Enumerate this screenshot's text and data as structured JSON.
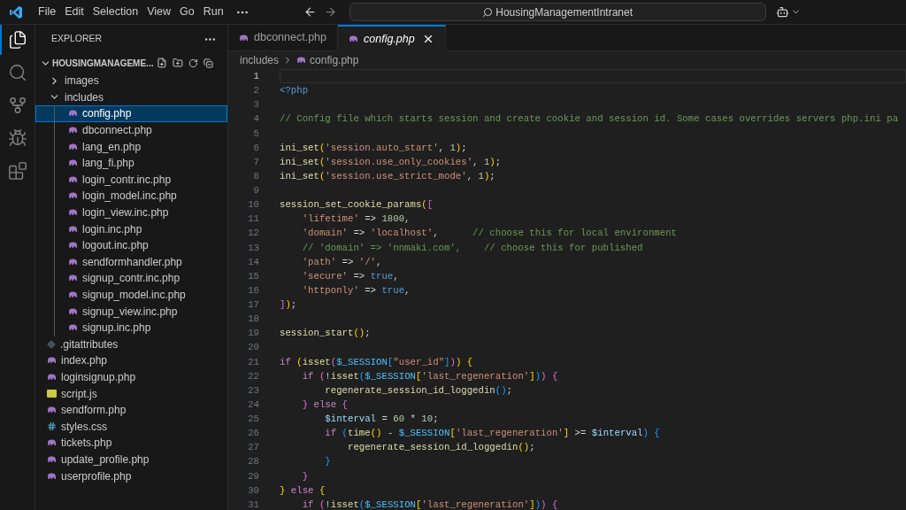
{
  "menu": [
    "File",
    "Edit",
    "Selection",
    "View",
    "Go",
    "Run"
  ],
  "search": {
    "value": "HousingManagementIntranet"
  },
  "activity_bar": [
    {
      "kind": "files",
      "selected": true
    },
    {
      "kind": "search",
      "selected": false
    },
    {
      "kind": "source-control",
      "selected": false
    },
    {
      "kind": "run",
      "selected": false
    },
    {
      "kind": "extensions",
      "selected": false
    }
  ],
  "explorer": {
    "title": "EXPLORER",
    "root": {
      "label": "HOUSINGMANAGEME...",
      "expanded": true,
      "children": [
        {
          "label": "images",
          "kind": "folder",
          "expanded": false,
          "selected": false
        },
        {
          "label": "includes",
          "kind": "folder",
          "expanded": true,
          "selected": false,
          "children": [
            {
              "label": "config.php",
              "kind": "php",
              "selected": true
            },
            {
              "label": "dbconnect.php",
              "kind": "php",
              "selected": false
            },
            {
              "label": "lang_en.php",
              "kind": "php",
              "selected": false
            },
            {
              "label": "lang_fi.php",
              "kind": "php",
              "selected": false
            },
            {
              "label": "login_contr.inc.php",
              "kind": "php",
              "selected": false
            },
            {
              "label": "login_model.inc.php",
              "kind": "php",
              "selected": false
            },
            {
              "label": "login_view.inc.php",
              "kind": "php",
              "selected": false
            },
            {
              "label": "login.inc.php",
              "kind": "php",
              "selected": false
            },
            {
              "label": "logout.inc.php",
              "kind": "php",
              "selected": false
            },
            {
              "label": "sendformhandler.php",
              "kind": "php",
              "selected": false
            },
            {
              "label": "signup_contr.inc.php",
              "kind": "php",
              "selected": false
            },
            {
              "label": "signup_model.inc.php",
              "kind": "php",
              "selected": false
            },
            {
              "label": "signup_view.inc.php",
              "kind": "php",
              "selected": false
            },
            {
              "label": "signup.inc.php",
              "kind": "php",
              "selected": false
            }
          ]
        },
        {
          "label": ".gitattributes",
          "kind": "git",
          "selected": false
        },
        {
          "label": "index.php",
          "kind": "php",
          "selected": false
        },
        {
          "label": "loginsignup.php",
          "kind": "php",
          "selected": false
        },
        {
          "label": "script.js",
          "kind": "js",
          "selected": false
        },
        {
          "label": "sendform.php",
          "kind": "php",
          "selected": false
        },
        {
          "label": "styles.css",
          "kind": "css",
          "selected": false
        },
        {
          "label": "tickets.php",
          "kind": "php",
          "selected": false
        },
        {
          "label": "update_profile.php",
          "kind": "php",
          "selected": false
        },
        {
          "label": "userprofile.php",
          "kind": "php",
          "selected": false
        }
      ]
    }
  },
  "tabs": [
    {
      "label": "dbconnect.php",
      "selected": false,
      "preview": false
    },
    {
      "label": "config.php",
      "selected": true,
      "preview": true
    }
  ],
  "breadcrumb": [
    "includes",
    "config.php"
  ],
  "code": [
    {
      "number": "1",
      "current": true
    },
    {
      "number": "2",
      "current": false,
      "tokens": [
        {
          "kind": "tag",
          "text": "<?php"
        }
      ]
    },
    {
      "number": "3",
      "current": false
    },
    {
      "number": "4",
      "current": false,
      "tokens": [
        {
          "kind": "comment",
          "text": "// Config file which starts session and create cookie and session id. Some cases overrides servers php.ini pa"
        }
      ]
    },
    {
      "number": "5",
      "current": false
    },
    {
      "number": "6",
      "current": false,
      "tokens": [
        {
          "kind": "fn",
          "text": "ini_set"
        },
        {
          "kind": "b1",
          "text": "("
        },
        {
          "kind": "str",
          "text": "'session.auto_start'"
        },
        {
          "kind": "p",
          "text": ", "
        },
        {
          "kind": "num",
          "text": "1"
        },
        {
          "kind": "b1",
          "text": ")"
        },
        {
          "kind": "p",
          "text": ";"
        }
      ]
    },
    {
      "number": "7",
      "current": false,
      "tokens": [
        {
          "kind": "fn",
          "text": "ini_set"
        },
        {
          "kind": "b1",
          "text": "("
        },
        {
          "kind": "str",
          "text": "'session.use_only_cookies'"
        },
        {
          "kind": "p",
          "text": ", "
        },
        {
          "kind": "num",
          "text": "1"
        },
        {
          "kind": "b1",
          "text": ")"
        },
        {
          "kind": "p",
          "text": ";"
        }
      ]
    },
    {
      "number": "8",
      "current": false,
      "tokens": [
        {
          "kind": "fn",
          "text": "ini_set"
        },
        {
          "kind": "b1",
          "text": "("
        },
        {
          "kind": "str",
          "text": "'session.use_strict_mode'"
        },
        {
          "kind": "p",
          "text": ", "
        },
        {
          "kind": "num",
          "text": "1"
        },
        {
          "kind": "b1",
          "text": ")"
        },
        {
          "kind": "p",
          "text": ";"
        }
      ]
    },
    {
      "number": "9",
      "current": false
    },
    {
      "number": "10",
      "current": false,
      "tokens": [
        {
          "kind": "fn",
          "text": "session_set_cookie_params"
        },
        {
          "kind": "b1",
          "text": "("
        },
        {
          "kind": "b2",
          "text": "["
        }
      ]
    },
    {
      "number": "11",
      "current": false,
      "tokens": [
        {
          "kind": "str",
          "text": "    'lifetime'"
        },
        {
          "kind": "p",
          "text": " => "
        },
        {
          "kind": "num",
          "text": "1800"
        },
        {
          "kind": "p",
          "text": ","
        }
      ]
    },
    {
      "number": "12",
      "current": false,
      "tokens": [
        {
          "kind": "str",
          "text": "    'domain'"
        },
        {
          "kind": "p",
          "text": " => "
        },
        {
          "kind": "str",
          "text": "'localhost'"
        },
        {
          "kind": "p",
          "text": ",      "
        },
        {
          "kind": "comment",
          "text": "// choose this for local environment"
        }
      ]
    },
    {
      "number": "13",
      "current": false,
      "tokens": [
        {
          "kind": "comment",
          "text": "    // 'domain' => 'nnmaki.com',    // choose this for published"
        }
      ]
    },
    {
      "number": "14",
      "current": false,
      "tokens": [
        {
          "kind": "str",
          "text": "    'path'"
        },
        {
          "kind": "p",
          "text": " => "
        },
        {
          "kind": "str",
          "text": "'/'"
        },
        {
          "kind": "p",
          "text": ","
        }
      ]
    },
    {
      "number": "15",
      "current": false,
      "tokens": [
        {
          "kind": "str",
          "text": "    'secure'"
        },
        {
          "kind": "p",
          "text": " => "
        },
        {
          "kind": "const",
          "text": "true"
        },
        {
          "kind": "p",
          "text": ","
        }
      ]
    },
    {
      "number": "16",
      "current": false,
      "tokens": [
        {
          "kind": "str",
          "text": "    'httponly'"
        },
        {
          "kind": "p",
          "text": " => "
        },
        {
          "kind": "const",
          "text": "true"
        },
        {
          "kind": "p",
          "text": ","
        }
      ]
    },
    {
      "number": "17",
      "current": false,
      "tokens": [
        {
          "kind": "b2",
          "text": "]"
        },
        {
          "kind": "b1",
          "text": ")"
        },
        {
          "kind": "p",
          "text": ";"
        }
      ]
    },
    {
      "number": "18",
      "current": false
    },
    {
      "number": "19",
      "current": false,
      "tokens": [
        {
          "kind": "fn",
          "text": "session_start"
        },
        {
          "kind": "b1",
          "text": "()"
        },
        {
          "kind": "p",
          "text": ";"
        }
      ]
    },
    {
      "number": "20",
      "current": false
    },
    {
      "number": "21",
      "current": false,
      "tokens": [
        {
          "kind": "kw",
          "text": "if "
        },
        {
          "kind": "b1",
          "text": "("
        },
        {
          "kind": "fn",
          "text": "isset"
        },
        {
          "kind": "b2",
          "text": "("
        },
        {
          "kind": "global",
          "text": "$_SESSION"
        },
        {
          "kind": "b3",
          "text": "["
        },
        {
          "kind": "str",
          "text": "\"user_id\""
        },
        {
          "kind": "b3",
          "text": "]"
        },
        {
          "kind": "b2",
          "text": ")"
        },
        {
          "kind": "b1",
          "text": ") {"
        }
      ]
    },
    {
      "number": "22",
      "current": false,
      "tokens": [
        {
          "kind": "kw",
          "text": "    if "
        },
        {
          "kind": "b2",
          "text": "("
        },
        {
          "kind": "p",
          "text": "!"
        },
        {
          "kind": "fn",
          "text": "isset"
        },
        {
          "kind": "b3",
          "text": "("
        },
        {
          "kind": "global",
          "text": "$_SESSION"
        },
        {
          "kind": "b1",
          "text": "["
        },
        {
          "kind": "str",
          "text": "'last_regeneration'"
        },
        {
          "kind": "b1",
          "text": "]"
        },
        {
          "kind": "b3",
          "text": ")"
        },
        {
          "kind": "b2",
          "text": ") {"
        }
      ]
    },
    {
      "number": "23",
      "current": false,
      "tokens": [
        {
          "kind": "fn",
          "text": "        regenerate_session_id_loggedin"
        },
        {
          "kind": "b3",
          "text": "()"
        },
        {
          "kind": "p",
          "text": ";"
        }
      ]
    },
    {
      "number": "24",
      "current": false,
      "tokens": [
        {
          "kind": "b2",
          "text": "    } "
        },
        {
          "kind": "kw",
          "text": "else "
        },
        {
          "kind": "b2",
          "text": "{"
        }
      ]
    },
    {
      "number": "25",
      "current": false,
      "tokens": [
        {
          "kind": "var",
          "text": "        $interval"
        },
        {
          "kind": "p",
          "text": " = "
        },
        {
          "kind": "num",
          "text": "60"
        },
        {
          "kind": "p",
          "text": " * "
        },
        {
          "kind": "num",
          "text": "10"
        },
        {
          "kind": "p",
          "text": ";"
        }
      ]
    },
    {
      "number": "26",
      "current": false,
      "tokens": [
        {
          "kind": "kw",
          "text": "        if "
        },
        {
          "kind": "b3",
          "text": "("
        },
        {
          "kind": "fn",
          "text": "time"
        },
        {
          "kind": "b1",
          "text": "()"
        },
        {
          "kind": "p",
          "text": " - "
        },
        {
          "kind": "global",
          "text": "$_SESSION"
        },
        {
          "kind": "b1",
          "text": "["
        },
        {
          "kind": "str",
          "text": "'last_regeneration'"
        },
        {
          "kind": "b1",
          "text": "]"
        },
        {
          "kind": "p",
          "text": " >= "
        },
        {
          "kind": "var",
          "text": "$interval"
        },
        {
          "kind": "b3",
          "text": ") {"
        }
      ]
    },
    {
      "number": "27",
      "current": false,
      "tokens": [
        {
          "kind": "fn",
          "text": "            regenerate_session_id_loggedin"
        },
        {
          "kind": "b1",
          "text": "()"
        },
        {
          "kind": "p",
          "text": ";"
        }
      ]
    },
    {
      "number": "28",
      "current": false,
      "tokens": [
        {
          "kind": "b3",
          "text": "        }"
        }
      ]
    },
    {
      "number": "29",
      "current": false,
      "tokens": [
        {
          "kind": "b2",
          "text": "    }"
        }
      ]
    },
    {
      "number": "30",
      "current": false,
      "tokens": [
        {
          "kind": "b1",
          "text": "} "
        },
        {
          "kind": "kw",
          "text": "else "
        },
        {
          "kind": "b1",
          "text": "{"
        }
      ]
    },
    {
      "number": "31",
      "current": false,
      "tokens": [
        {
          "kind": "kw",
          "text": "    if "
        },
        {
          "kind": "b2",
          "text": "("
        },
        {
          "kind": "p",
          "text": "!"
        },
        {
          "kind": "fn",
          "text": "isset"
        },
        {
          "kind": "b3",
          "text": "("
        },
        {
          "kind": "global",
          "text": "$_SESSION"
        },
        {
          "kind": "b1",
          "text": "["
        },
        {
          "kind": "str",
          "text": "'last_regeneration'"
        },
        {
          "kind": "b1",
          "text": "]"
        },
        {
          "kind": "b3",
          "text": ")"
        },
        {
          "kind": "b2",
          "text": ") {"
        }
      ]
    }
  ]
}
